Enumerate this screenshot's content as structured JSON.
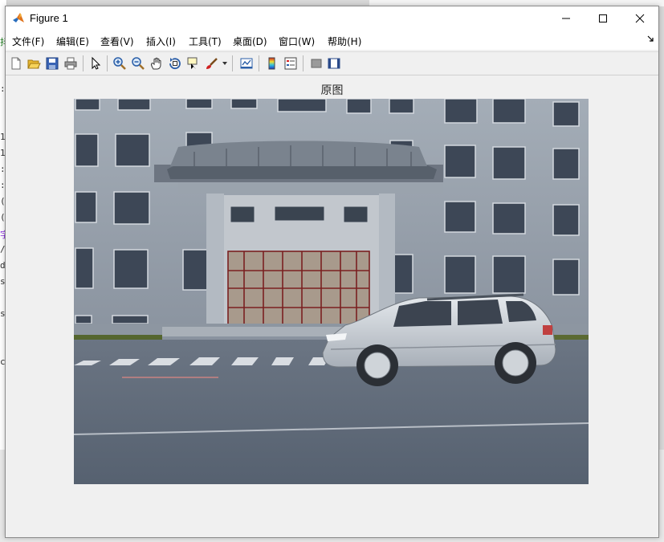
{
  "window": {
    "title": "Figure 1",
    "icon": "matlab-logo-icon"
  },
  "menu": {
    "items": [
      {
        "label": "文件(F)"
      },
      {
        "label": "编辑(E)"
      },
      {
        "label": "查看(V)"
      },
      {
        "label": "插入(I)"
      },
      {
        "label": "工具(T)"
      },
      {
        "label": "桌面(D)"
      },
      {
        "label": "窗口(W)"
      },
      {
        "label": "帮助(H)"
      }
    ]
  },
  "toolbar": {
    "tools": [
      "new-figure-icon",
      "open-file-icon",
      "save-icon",
      "print-icon",
      "edit-plot-arrow-icon",
      "zoom-in-icon",
      "zoom-out-icon",
      "pan-hand-icon",
      "rotate-3d-icon",
      "data-cursor-icon",
      "brush-icon",
      "link-plot-icon",
      "colorbar-icon",
      "legend-icon",
      "hide-plot-tools-icon",
      "show-plot-tools-icon"
    ]
  },
  "axes": {
    "title": "原图"
  },
  "background_text": {
    "left_glyphs": [
      "抖",
      ":",
      "1",
      "1",
      ":",
      ":",
      "(",
      "(",
      "字",
      "/",
      "d",
      "s",
      "s",
      "c"
    ]
  },
  "colors": {
    "sky_building": "#8e98a3",
    "road": "#5f6a77",
    "car": "#c7ccd3"
  }
}
